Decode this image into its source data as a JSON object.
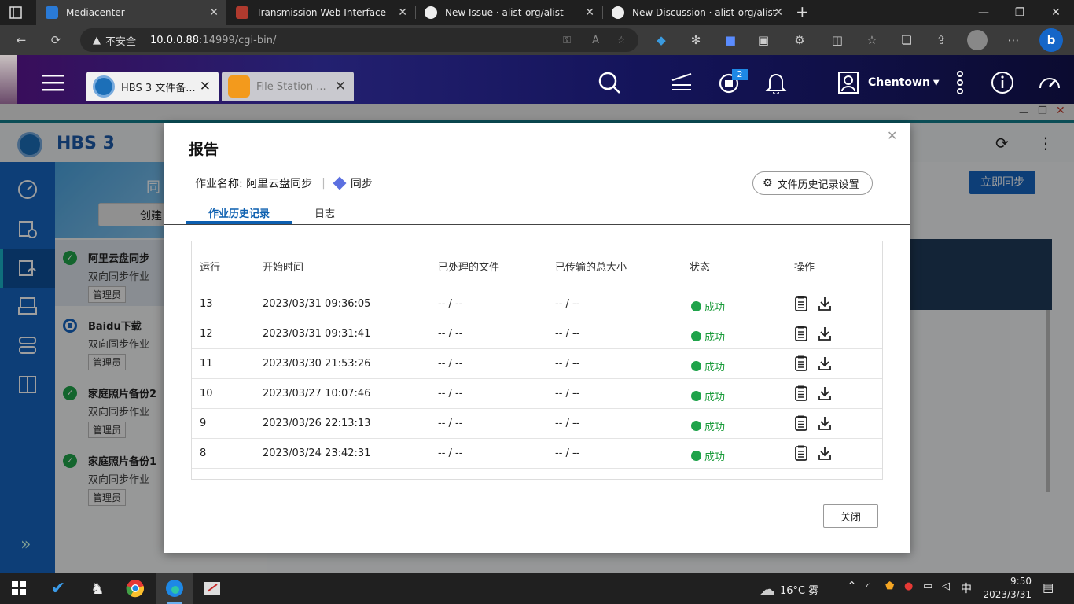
{
  "browser": {
    "tabs": [
      {
        "label": "Mediacenter",
        "active": true
      },
      {
        "label": "Transmission Web Interface",
        "active": false
      },
      {
        "label": "New Issue · alist-org/alist",
        "active": false
      },
      {
        "label": "New Discussion · alist-org/alist",
        "active": false
      }
    ],
    "new_tab": "+",
    "security_label": "不安全",
    "url_host": "10.0.0.88",
    "url_rest": ":14999/cgi-bin/",
    "window_controls": {
      "minimize": "—",
      "restore": "❐",
      "close": "✕"
    }
  },
  "qnap": {
    "app_tabs": [
      {
        "label": "HBS 3 文件备...",
        "active": true
      },
      {
        "label": "File Station ...",
        "active": false
      }
    ],
    "notification_badge": "2",
    "user_name": "Chentown"
  },
  "hbs": {
    "app_name": "HBS 3",
    "sync_now_label": "立即同步",
    "create_label": "创建",
    "partial_title": "同",
    "jobs": [
      {
        "name": "阿里云盘同步",
        "type": "双向同步作业",
        "role": "管理员",
        "status": "ok"
      },
      {
        "name": "Baidu下载",
        "type": "双向同步作业",
        "role": "管理员",
        "status": "stopped"
      },
      {
        "name": "家庭照片备份2",
        "type": "双向同步作业",
        "role": "管理员",
        "status": "ok"
      },
      {
        "name": "家庭照片备份1",
        "type": "双向同步作业",
        "role": "管理员",
        "status": "ok"
      }
    ],
    "expand_label": "»"
  },
  "modal": {
    "title": "报告",
    "job_label": "作业名称: 阿里云盘同步",
    "sync_type": "同步",
    "history_settings_label": "文件历史记录设置",
    "tabs": [
      {
        "label": "作业历史记录",
        "active": true
      },
      {
        "label": "日志",
        "active": false
      }
    ],
    "columns": [
      "运行",
      "开始时间",
      "已处理的文件",
      "已传输的总大小",
      "状态",
      "操作"
    ],
    "rows": [
      {
        "run": "13",
        "start": "2023/03/31 09:36:05",
        "files": "-- / --",
        "size": "-- / --",
        "status": "成功"
      },
      {
        "run": "12",
        "start": "2023/03/31 09:31:41",
        "files": "-- / --",
        "size": "-- / --",
        "status": "成功"
      },
      {
        "run": "11",
        "start": "2023/03/30 21:53:26",
        "files": "-- / --",
        "size": "-- / --",
        "status": "成功"
      },
      {
        "run": "10",
        "start": "2023/03/27 10:07:46",
        "files": "-- / --",
        "size": "-- / --",
        "status": "成功"
      },
      {
        "run": "9",
        "start": "2023/03/26 22:13:13",
        "files": "-- / --",
        "size": "-- / --",
        "status": "成功"
      },
      {
        "run": "8",
        "start": "2023/03/24 23:42:31",
        "files": "-- / --",
        "size": "-- / --",
        "status": "成功"
      }
    ],
    "close_label": "关闭"
  },
  "taskbar": {
    "weather": "16°C 雾",
    "ime": "中",
    "time": "9:50",
    "date": "2023/3/31"
  },
  "colors": {
    "hbs_blue": "#1565c0",
    "active_tab": "#0c5fb0",
    "success": "#1fa34a",
    "accent_line": "#127d8c"
  }
}
